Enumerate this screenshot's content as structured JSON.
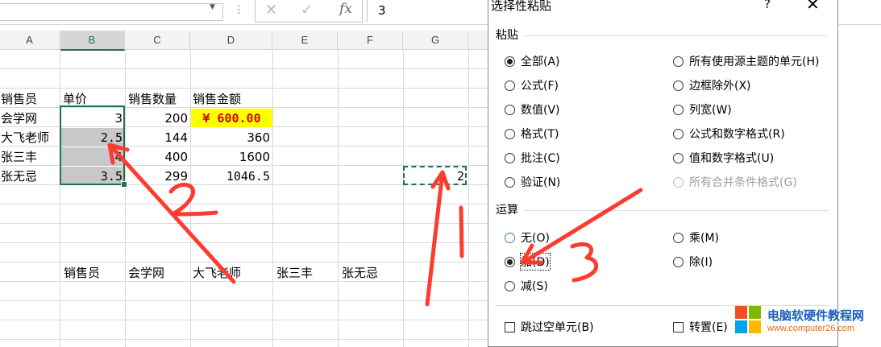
{
  "formula_bar": {
    "cancel_icon": "cancel-x-icon",
    "enter_icon": "enter-check-icon",
    "fx_label": "fx",
    "value": "3"
  },
  "sheet": {
    "columns": [
      "A",
      "B",
      "C",
      "D",
      "E",
      "F",
      "G"
    ],
    "selected_column": "B",
    "header_row": [
      "销售员",
      "单价",
      "销售数量",
      "销售金额"
    ],
    "rows": [
      {
        "name": "会学网",
        "price": "3",
        "qty": "200",
        "amount": "¥ 600.00"
      },
      {
        "name": "大飞老师",
        "price": "2.5",
        "qty": "144",
        "amount": "360"
      },
      {
        "name": "张三丰",
        "price": "4",
        "qty": "400",
        "amount": "1600"
      },
      {
        "name": "张无忌",
        "price": "3.5",
        "qty": "299",
        "amount": "1046.5"
      }
    ],
    "copied_value": "2",
    "transposed_row": [
      "销售员",
      "会学网",
      "大飞老师",
      "张三丰",
      "张无忌"
    ],
    "highlight_color": "#ffff00",
    "selection_color": "#217346"
  },
  "dialog": {
    "title": "选择性粘贴",
    "help": "?",
    "close": "✕",
    "paste_section": "粘贴",
    "paste_left": [
      "全部(A)",
      "公式(F)",
      "数值(V)",
      "格式(T)",
      "批注(C)",
      "验证(N)"
    ],
    "paste_right": [
      "所有使用源主题的单元(H)",
      "边框除外(X)",
      "列宽(W)",
      "公式和数字格式(R)",
      "值和数字格式(U)",
      "所有合并条件格式(G)"
    ],
    "paste_selected": "全部(A)",
    "operation_section": "运算",
    "op_left": [
      "无(O)",
      "加(D)",
      "减(S)"
    ],
    "op_right": [
      "乘(M)",
      "除(I)"
    ],
    "op_selected": "加(D)",
    "skip_blanks": "跳过空单元(B)",
    "transpose": "转置(E)"
  },
  "annotations": {
    "labels": [
      "1",
      "2",
      "3"
    ],
    "color": "#ff3b30"
  },
  "watermark": {
    "title": "电脑软硬件教程网",
    "url": "www.computer26.com"
  }
}
